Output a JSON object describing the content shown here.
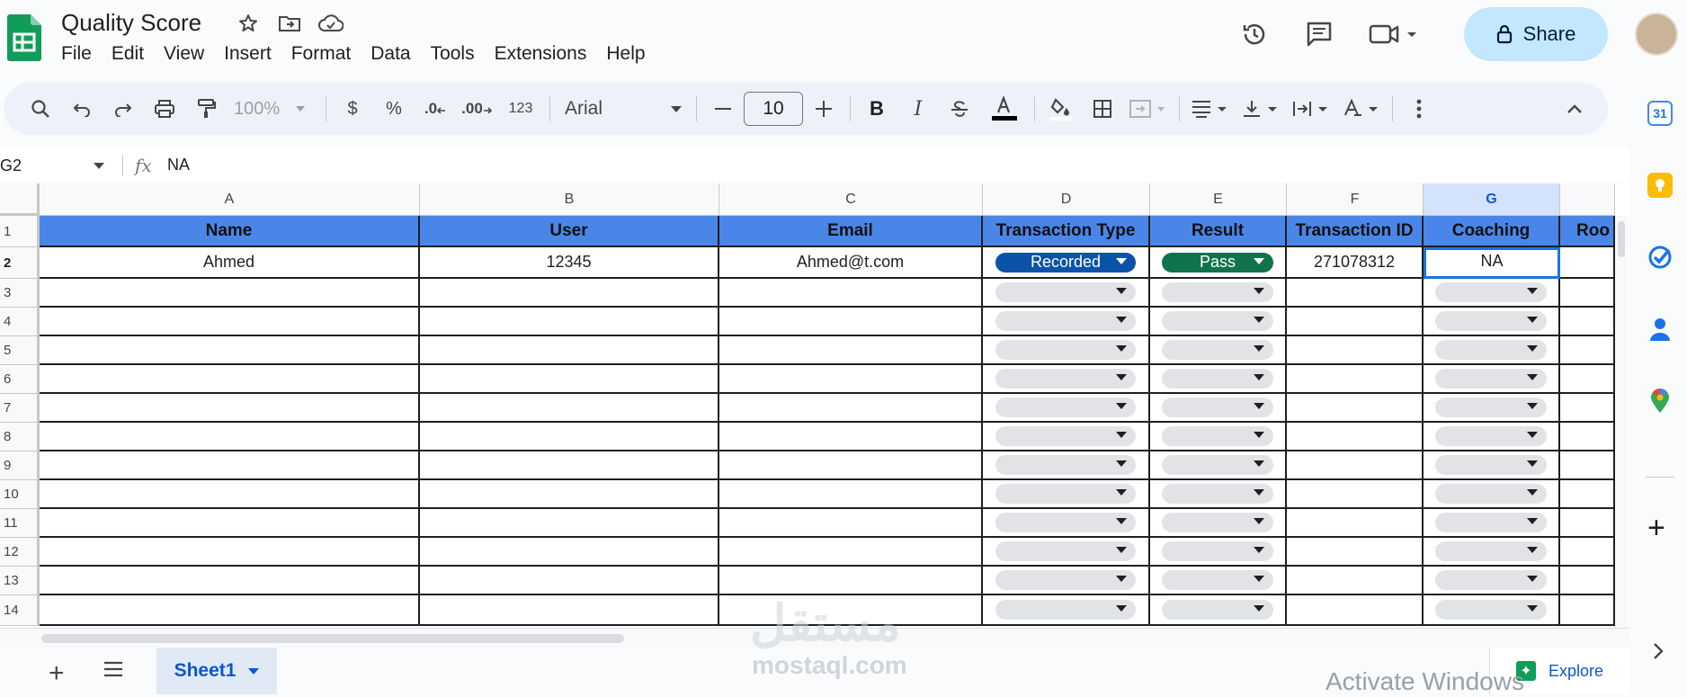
{
  "app": {
    "title": "Quality Score",
    "menu": [
      "File",
      "Edit",
      "View",
      "Insert",
      "Format",
      "Data",
      "Tools",
      "Extensions",
      "Help"
    ],
    "share_label": "Share"
  },
  "toolbar": {
    "zoom": "100%",
    "currency": "$",
    "percent": "%",
    "dec_decrease": ".0",
    "dec_increase": ".00",
    "number_format": "123",
    "font": "Arial",
    "font_size": "10",
    "bold": "B",
    "italic": "I"
  },
  "formula_bar": {
    "cell_ref": "G2",
    "fx": "fx",
    "value": "NA"
  },
  "grid": {
    "columns": [
      "A",
      "B",
      "C",
      "D",
      "E",
      "F",
      "G"
    ],
    "selected_column": "G",
    "rows": [
      "1",
      "2",
      "3",
      "4",
      "5",
      "6",
      "7",
      "8",
      "9",
      "10",
      "11",
      "12",
      "13",
      "14"
    ],
    "selected_row": "2",
    "headers": [
      "Name",
      "User",
      "Email",
      "Transaction Type",
      "Result",
      "Transaction ID",
      "Coaching",
      "Roo"
    ],
    "row2": {
      "name": "Ahmed",
      "user": "12345",
      "email": "Ahmed@t.com",
      "transaction_type": "Recorded",
      "result": "Pass",
      "transaction_id": "271078312",
      "coaching": "NA"
    },
    "colors": {
      "header_fill": "#4a86e8",
      "recorded_chip": "#0a53a8",
      "pass_chip": "#11734b",
      "selection": "#1a73e8"
    }
  },
  "bottom": {
    "sheet_tab": "Sheet1",
    "explore_label": "Explore",
    "activate_windows": "Activate Windows",
    "watermark_ar": "مستقل",
    "watermark_en": "mostaql.com"
  },
  "side_panel": {
    "calendar_day": "31"
  }
}
